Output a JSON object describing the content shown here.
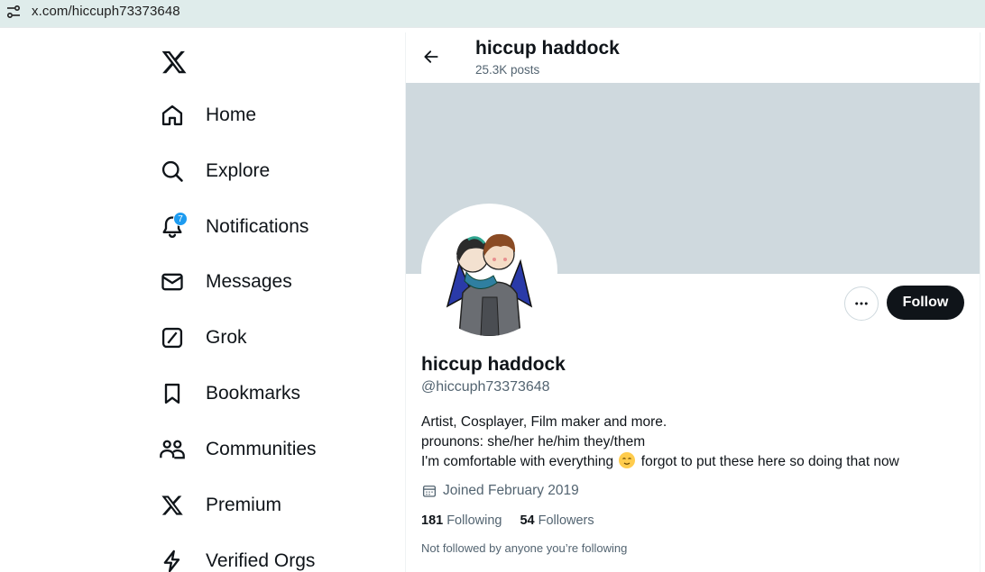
{
  "browser": {
    "url": "x.com/hiccuph73373648",
    "icon": "site-settings-icon"
  },
  "nav": {
    "logo": "x-logo-icon",
    "items": [
      {
        "label": "Home",
        "icon": "home-icon"
      },
      {
        "label": "Explore",
        "icon": "search-icon"
      },
      {
        "label": "Notifications",
        "icon": "bell-icon",
        "badge": "7"
      },
      {
        "label": "Messages",
        "icon": "envelope-icon"
      },
      {
        "label": "Grok",
        "icon": "grok-icon"
      },
      {
        "label": "Bookmarks",
        "icon": "bookmark-icon"
      },
      {
        "label": "Communities",
        "icon": "people-icon"
      },
      {
        "label": "Premium",
        "icon": "x-logo-icon"
      },
      {
        "label": "Verified Orgs",
        "icon": "lightning-icon"
      }
    ]
  },
  "header": {
    "name": "hiccup haddock",
    "posts": "25.3K posts"
  },
  "profile": {
    "display_name": "hiccup haddock",
    "handle": "@hiccuph73373648",
    "follow_label": "Follow",
    "bio": {
      "line1": "Artist, Cosplayer, Film maker and more.",
      "line2": "prounons: she/her he/him they/them",
      "line3_before": "I'm comfortable with everything",
      "line3_after": "forgot to put these here so doing that now"
    },
    "joined": "Joined February 2019",
    "following_count": "181",
    "following_label": "Following",
    "followers_count": "54",
    "followers_label": "Followers",
    "not_followed": "Not followed by anyone you’re following"
  },
  "colors": {
    "accent": "#1d9bf0",
    "text": "#0f1419",
    "secondary": "#536471",
    "banner": "#cfd9de"
  }
}
